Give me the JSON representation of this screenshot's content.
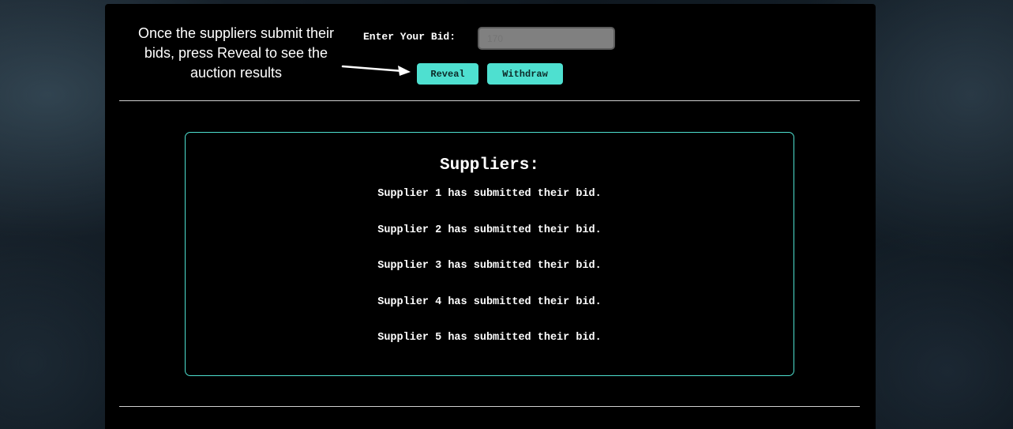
{
  "annotation": {
    "text": "Once the suppliers submit their bids, press Reveal to see the auction results"
  },
  "bid": {
    "label": "Enter Your Bid:",
    "placeholder": "170",
    "value": ""
  },
  "buttons": {
    "reveal": "Reveal",
    "withdraw": "Withdraw"
  },
  "suppliers": {
    "title": "Suppliers:",
    "items": [
      "Supplier 1 has submitted their bid.",
      "Supplier 2 has submitted their bid.",
      "Supplier 3 has submitted their bid.",
      "Supplier 4 has submitted their bid.",
      "Supplier 5 has submitted their bid."
    ]
  },
  "colors": {
    "accent": "#4ee0d0",
    "panel": "#000000",
    "input_bg": "#808080"
  },
  "icons": {
    "arrow": "arrow-right-icon"
  }
}
